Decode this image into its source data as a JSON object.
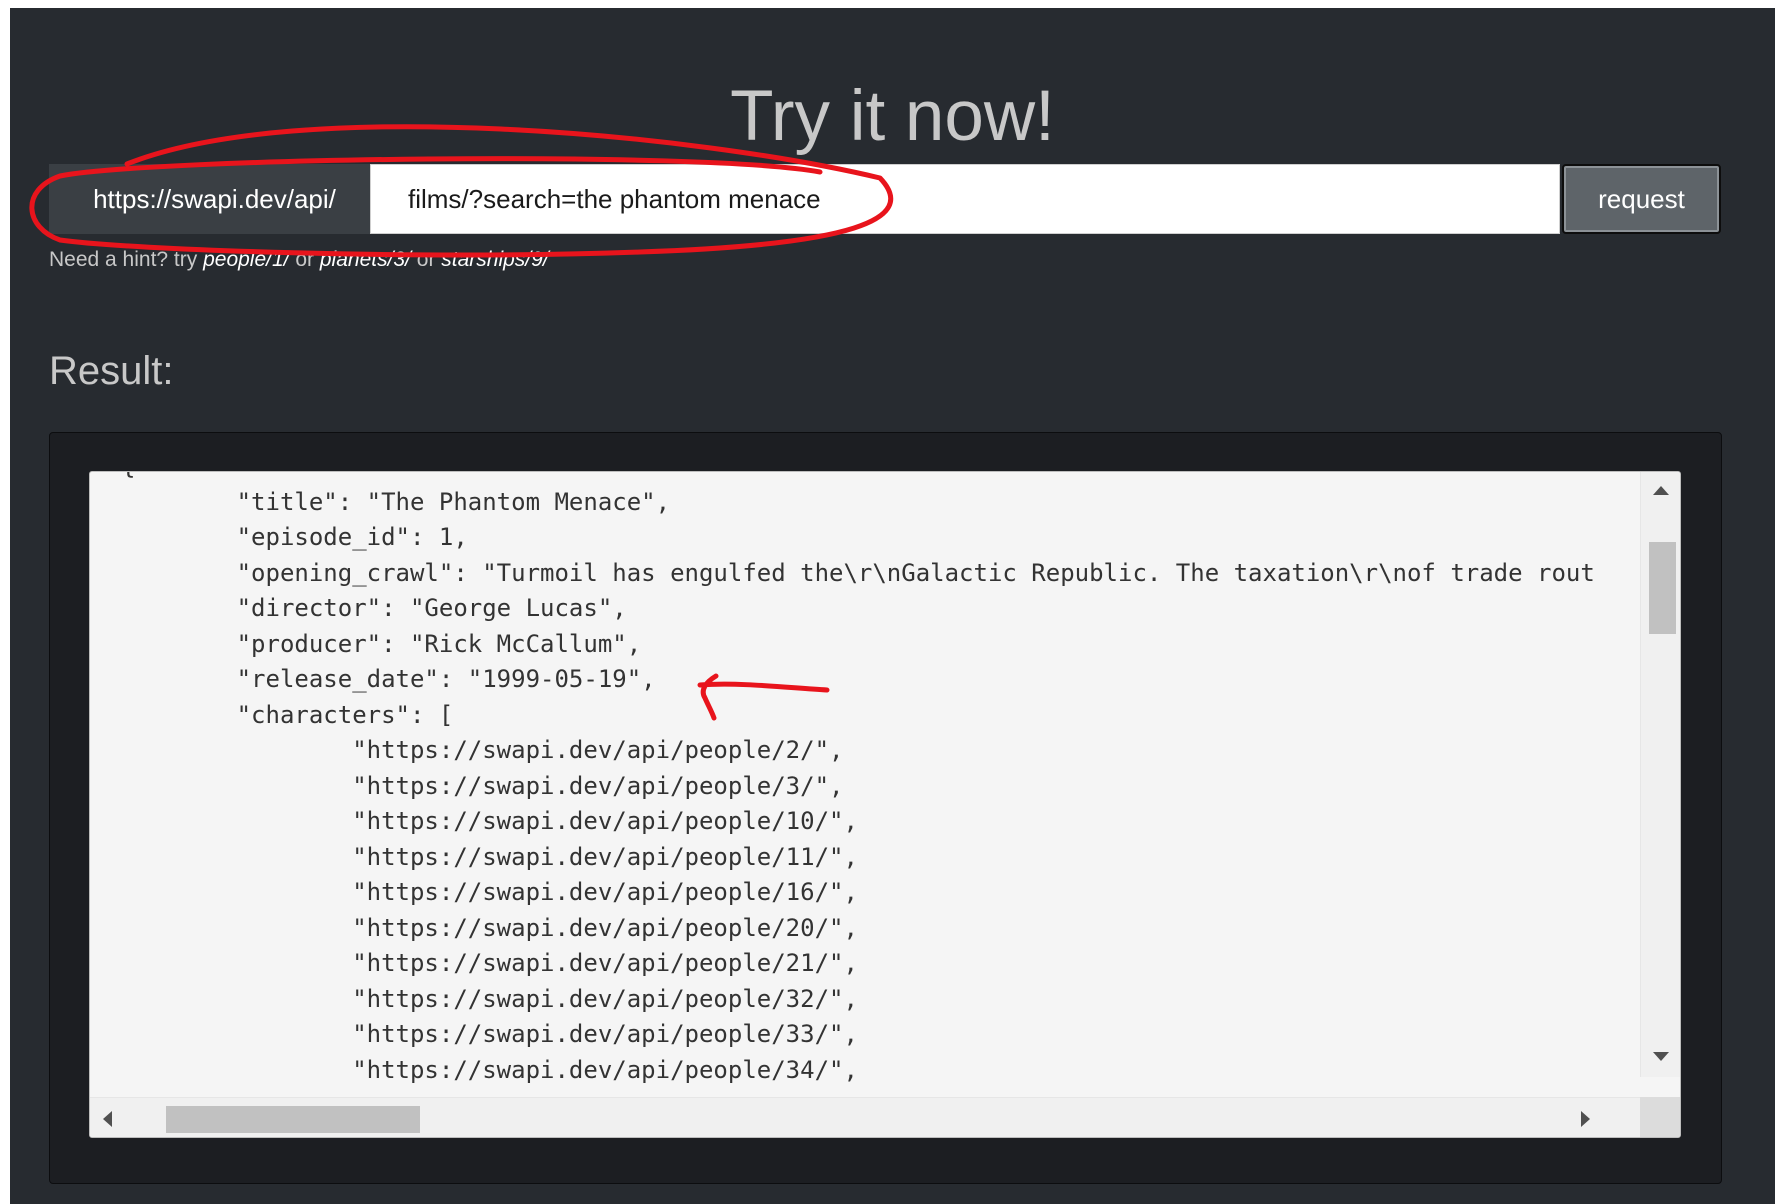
{
  "heading": "Try it now!",
  "request_form": {
    "base_url": "https://swapi.dev/api/",
    "path_value": "films/?search=the phantom menace",
    "button_label": "request"
  },
  "hint": {
    "prefix": "Need a hint? try ",
    "link1": "people/1/",
    "sep1": " or ",
    "link2": "planets/3/",
    "sep2": " or ",
    "link3": "starships/9/"
  },
  "result": {
    "label": "Result:",
    "lines": [
      "{",
      "\t\"title\": \"The Phantom Menace\",",
      "\t\"episode_id\": 1,",
      "\t\"opening_crawl\": \"Turmoil has engulfed the\\r\\nGalactic Republic. The taxation\\r\\nof trade rout",
      "\t\"director\": \"George Lucas\",",
      "\t\"producer\": \"Rick McCallum\",",
      "\t\"release_date\": \"1999-05-19\",",
      "\t\"characters\": [",
      "\t\t\"https://swapi.dev/api/people/2/\",",
      "\t\t\"https://swapi.dev/api/people/3/\",",
      "\t\t\"https://swapi.dev/api/people/10/\",",
      "\t\t\"https://swapi.dev/api/people/11/\",",
      "\t\t\"https://swapi.dev/api/people/16/\",",
      "\t\t\"https://swapi.dev/api/people/20/\",",
      "\t\t\"https://swapi.dev/api/people/21/\",",
      "\t\t\"https://swapi.dev/api/people/32/\",",
      "\t\t\"https://swapi.dev/api/people/33/\",",
      "\t\t\"https://swapi.dev/api/people/34/\","
    ]
  },
  "colors": {
    "panel_bg": "#272b30",
    "annotation": "#e8141c"
  },
  "icons": {
    "scroll_up": "triangle-up-icon",
    "scroll_down": "triangle-down-icon",
    "scroll_left": "triangle-left-icon",
    "scroll_right": "triangle-right-icon"
  }
}
